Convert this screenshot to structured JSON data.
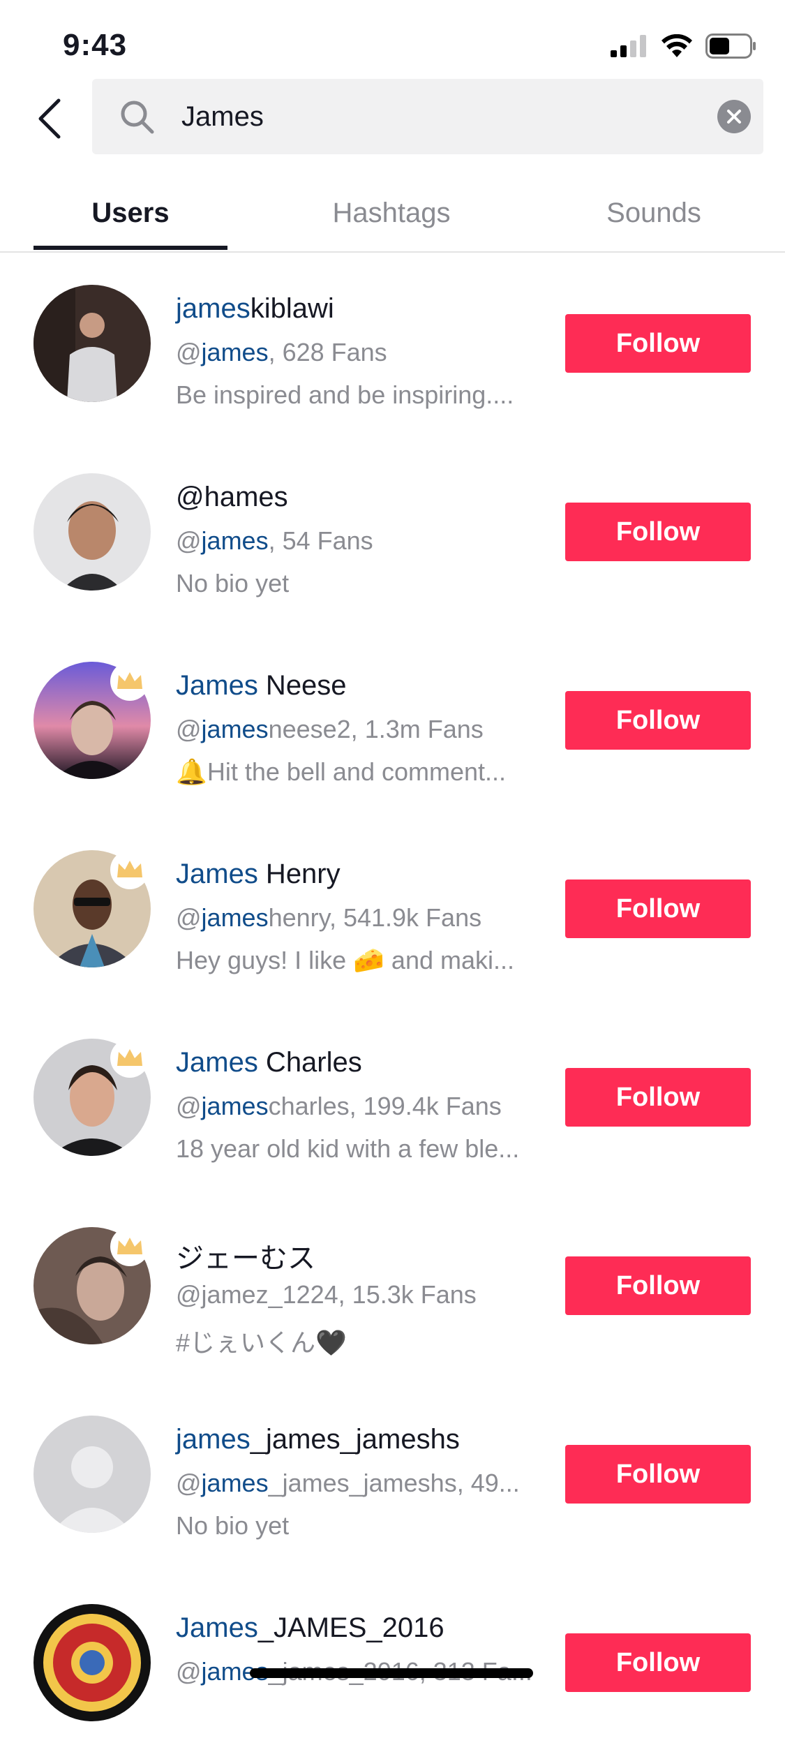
{
  "status_bar": {
    "time": "9:43"
  },
  "search": {
    "query": "James",
    "placeholder": "Search"
  },
  "tabs": [
    {
      "label": "Users",
      "active": true
    },
    {
      "label": "Hashtags",
      "active": false
    },
    {
      "label": "Sounds",
      "active": false
    }
  ],
  "users": [
    {
      "name_hl": "james",
      "name_rest": "kiblawi",
      "handle_at": "@",
      "handle_hl": "james",
      "handle_rest": ", 628 Fans",
      "bio": "Be inspired and be inspiring....",
      "crown": false,
      "avatar": "photo",
      "follow_label": "Follow"
    },
    {
      "name_hl": "",
      "name_rest": "@hames",
      "handle_at": "@",
      "handle_hl": "james",
      "handle_rest": ", 54 Fans",
      "bio": "No bio yet",
      "crown": false,
      "avatar": "photo",
      "follow_label": "Follow"
    },
    {
      "name_hl": "James",
      "name_rest": " Neese",
      "handle_at": "@",
      "handle_hl": "james",
      "handle_rest": "neese2, 1.3m Fans",
      "bio": "🔔Hit the bell and comment...",
      "crown": true,
      "avatar": "photo",
      "follow_label": "Follow"
    },
    {
      "name_hl": "James",
      "name_rest": " Henry",
      "handle_at": "@",
      "handle_hl": "james",
      "handle_rest": "henry, 541.9k Fans",
      "bio": "Hey guys! I like 🧀  and maki...",
      "crown": true,
      "avatar": "photo",
      "follow_label": "Follow"
    },
    {
      "name_hl": "James",
      "name_rest": " Charles",
      "handle_at": "@",
      "handle_hl": "james",
      "handle_rest": "charles, 199.4k Fans",
      "bio": "18 year old kid with a few ble...",
      "crown": true,
      "avatar": "photo",
      "follow_label": "Follow"
    },
    {
      "name_hl": "",
      "name_rest": "ジェーむス",
      "handle_at": "",
      "handle_hl": "",
      "handle_rest": "@jamez_1224, 15.3k Fans",
      "bio": "#じぇいくん🖤",
      "crown": true,
      "avatar": "photo",
      "follow_label": "Follow"
    },
    {
      "name_hl": "james",
      "name_rest": "_james_jameshs",
      "handle_at": "@",
      "handle_hl": "james",
      "handle_rest": "_james_jameshs, 49...",
      "bio": "No bio yet",
      "crown": false,
      "avatar": "placeholder",
      "follow_label": "Follow"
    },
    {
      "name_hl": "James",
      "name_rest": "_JAMES_2016",
      "handle_at": "@",
      "handle_hl": "james",
      "handle_rest": "_james_2016, 313 Fa...",
      "bio": "",
      "crown": false,
      "avatar": "emblem",
      "follow_label": "Follow"
    }
  ],
  "icons": {
    "back": "chevron-left-icon",
    "search": "search-icon",
    "clear": "close-icon",
    "crown": "crown-icon"
  },
  "colors": {
    "follow": "#fe2c55",
    "highlight": "#104c8a",
    "secondary_text": "#8a8b91",
    "search_bg": "#f1f1f2"
  }
}
